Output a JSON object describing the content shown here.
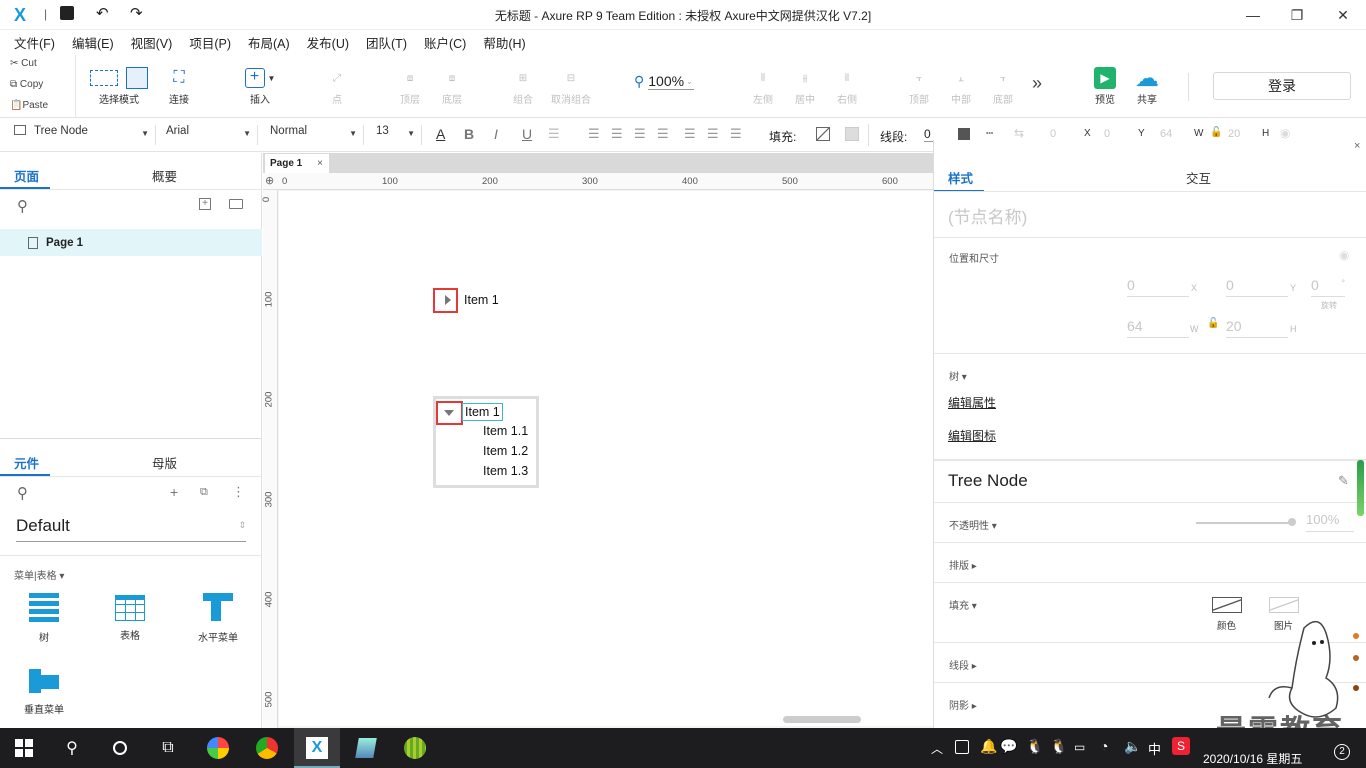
{
  "window": {
    "title": "无标题 - Axure RP 9 Team Edition : 未授权    Axure中文网提供汉化 V7.2]"
  },
  "menu": [
    "文件(F)",
    "编辑(E)",
    "视图(V)",
    "项目(P)",
    "布局(A)",
    "发布(U)",
    "团队(T)",
    "账户(C)",
    "帮助(H)"
  ],
  "clipboard": {
    "cut": "Cut",
    "copy": "Copy",
    "paste": "Paste"
  },
  "toolbar": {
    "select_mode": "选择模式",
    "connect": "连接",
    "insert": "插入",
    "point": "点",
    "top_layer": "顶层",
    "bottom_layer": "底层",
    "group": "组合",
    "ungroup": "取消组合",
    "zoom": "100%",
    "align_left": "左侧",
    "align_center": "居中",
    "align_right": "右侧",
    "align_top": "顶部",
    "align_middle": "中部",
    "align_bottom": "底部",
    "more": "»",
    "preview": "预览",
    "share": "共享",
    "login": "登录"
  },
  "format": {
    "style": "Tree Node",
    "font": "Arial",
    "weight": "Normal",
    "size": "13",
    "fill_label": "填充:",
    "stroke_label": "线段:",
    "stroke_value": "0",
    "x_value": "0",
    "x_label": "X",
    "x_pos": "0",
    "y_label": "Y",
    "y_pos": "64",
    "w_label": "W",
    "w_value": "20",
    "h_label": "H"
  },
  "left_panel": {
    "tabs": [
      "页面",
      "概要"
    ],
    "pages": [
      "Page 1"
    ],
    "widget_tabs": [
      "元件",
      "母版"
    ],
    "library": "Default",
    "category": "菜单|表格 ▾",
    "widgets": [
      "树",
      "表格",
      "水平菜单",
      "垂直菜单"
    ]
  },
  "canvas": {
    "page_tab": "Page 1",
    "ruler_h": [
      "0",
      "100",
      "200",
      "300",
      "400",
      "500",
      "600"
    ],
    "ruler_v": [
      "0",
      "100",
      "200",
      "300",
      "400",
      "500"
    ],
    "tree_collapsed": "Item 1",
    "tree_expanded": {
      "root": "Item 1",
      "children": [
        "Item 1.1",
        "Item 1.2",
        "Item 1.3"
      ]
    }
  },
  "right_panel": {
    "tabs": [
      "样式",
      "交互"
    ],
    "node_name_placeholder": "(节点名称)",
    "position_size": "位置和尺寸",
    "x": "0",
    "x_l": "X",
    "y": "0",
    "y_l": "Y",
    "rot": "0",
    "rot_unit": "°",
    "rot_l": "旋转",
    "w": "64",
    "w_l": "W",
    "h": "20",
    "h_l": "H",
    "tree_label": "树 ▾",
    "edit_props": "编辑属性",
    "edit_icons": "编辑图标",
    "style_name": "Tree Node",
    "opacity_label": "不透明性 ▾",
    "opacity": "100%",
    "layout_label": "排版 ▸",
    "fill_label": "填充 ▾",
    "fill_color": "颜色",
    "fill_image": "图片",
    "stroke_label": "线段 ▸",
    "shadow_label": "阴影 ▸"
  },
  "watermark": "最需教育",
  "taskbar": {
    "clock": "2020/10/16 星期五",
    "ime": "中",
    "notify_count": "2"
  }
}
